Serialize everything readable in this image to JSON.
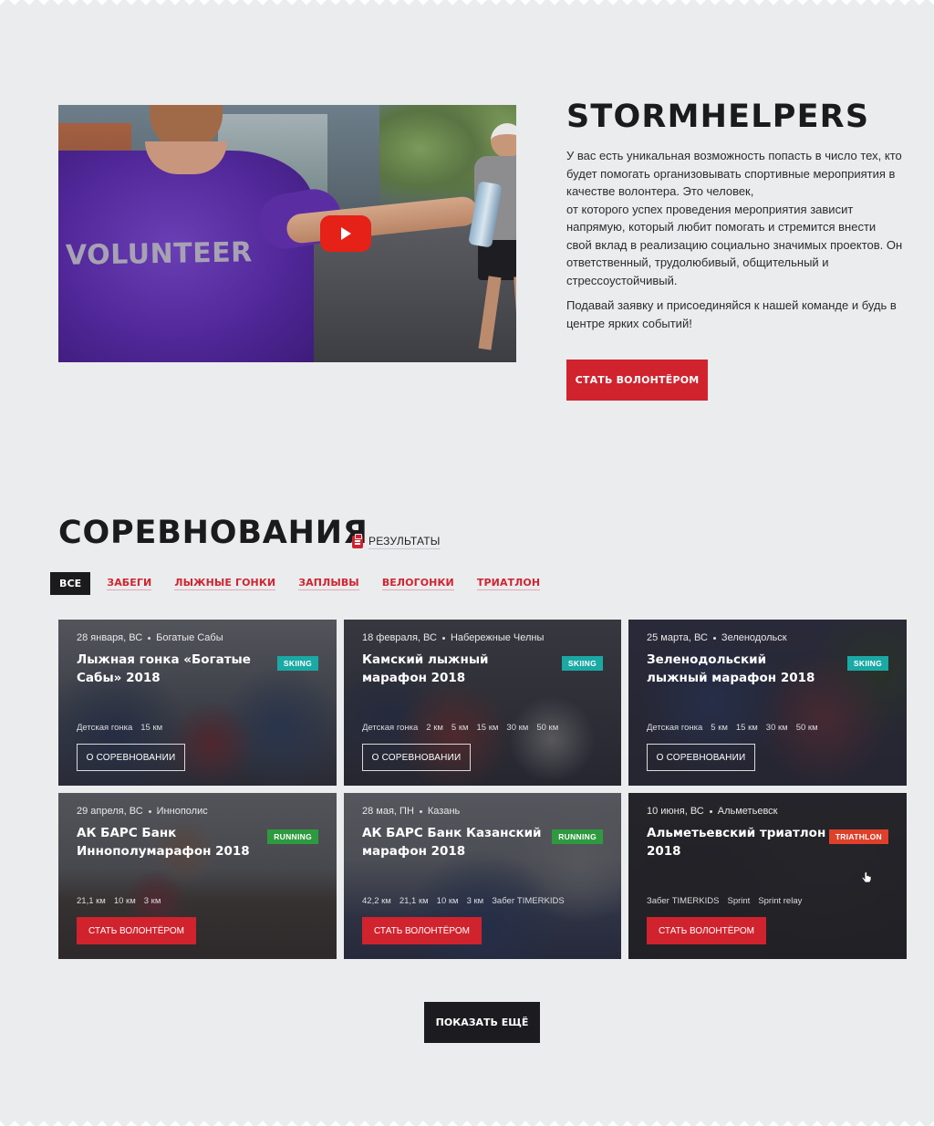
{
  "hero": {
    "video_overlay_text": "VOLUNTEER",
    "title": "STORMHELPERS",
    "paragraphs": [
      "У вас есть уникальная возможность попасть в число тех, кто будет помогать организовывать спортивные мероприятия в качестве волонтера. Это человек,\nот которого успех проведения мероприятия зависит напрямую, который любит помогать и стремится внести свой вклад в реализацию социально значимых проектов. Он ответственный, трудолюбивый, общительный и стрессоустойчивый.",
      "Подавай заявку и присоединяйся к нашей команде и будь в центре ярких событий!"
    ],
    "cta_label": "Стать волонтёром"
  },
  "competitions": {
    "title": "СОРЕВНОВАНИЯ",
    "results_label": "Результаты",
    "filters": [
      "Все",
      "Забеги",
      "Лыжные гонки",
      "Заплывы",
      "Велогонки",
      "Триатлон"
    ],
    "cards": [
      {
        "date": "28 января, ВС",
        "place": "Богатые Сабы",
        "name": "Лыжная гонка «Богатые Сабы» 2018",
        "tag": "SKIING",
        "tag_color": "#1aa9a4",
        "distances": [
          "Детская гонка",
          "15 км"
        ],
        "button": "О соревновании"
      },
      {
        "date": "18 февраля, ВС",
        "place": "Набережные Челны",
        "name": "Камский лыжный марафон 2018",
        "tag": "SKIING",
        "tag_color": "#1aa9a4",
        "distances": [
          "Детская гонка",
          "2 км",
          "5 км",
          "15 км",
          "30 км",
          "50 км"
        ],
        "button": "О соревновании"
      },
      {
        "date": "25 марта, ВС",
        "place": "Зеленодольск",
        "name": "Зеленодольский лыжный марафон 2018",
        "tag": "SKIING",
        "tag_color": "#1aa9a4",
        "distances": [
          "Детская гонка",
          "5 км",
          "15 км",
          "30 км",
          "50 км"
        ],
        "button": "О соревновании"
      },
      {
        "date": "29 апреля, ВС",
        "place": "Иннополис",
        "name": "АК БАРС Банк Иннополумарафон 2018",
        "tag": "RUNNING",
        "tag_color": "#2e9a3f",
        "distances": [
          "21,1 км",
          "10 км",
          "3 км"
        ],
        "button": "Стать волонтёром"
      },
      {
        "date": "28 мая, ПН",
        "place": "Казань",
        "name": "АК БАРС Банк Казанский марафон 2018",
        "tag": "RUNNING",
        "tag_color": "#2e9a3f",
        "distances": [
          "42,2 км",
          "21,1 км",
          "10 км",
          "3 км",
          "Забег TIMERKIDS"
        ],
        "button": "Стать волонтёром"
      },
      {
        "date": "10 июня, ВС",
        "place": "Альметьевск",
        "name": "Альметьевский триатлон 2018",
        "tag": "TRIATHLON",
        "tag_color": "#e0402a",
        "distances": [
          "Забег TIMERKIDS",
          "Sprint",
          "Sprint relay"
        ],
        "button": "Стать волонтёром"
      }
    ],
    "more_label": "Показать ещё"
  },
  "colors": {
    "accent_red": "#d0232e",
    "page_bg": "#ebecee",
    "dark": "#1b1b1d"
  }
}
